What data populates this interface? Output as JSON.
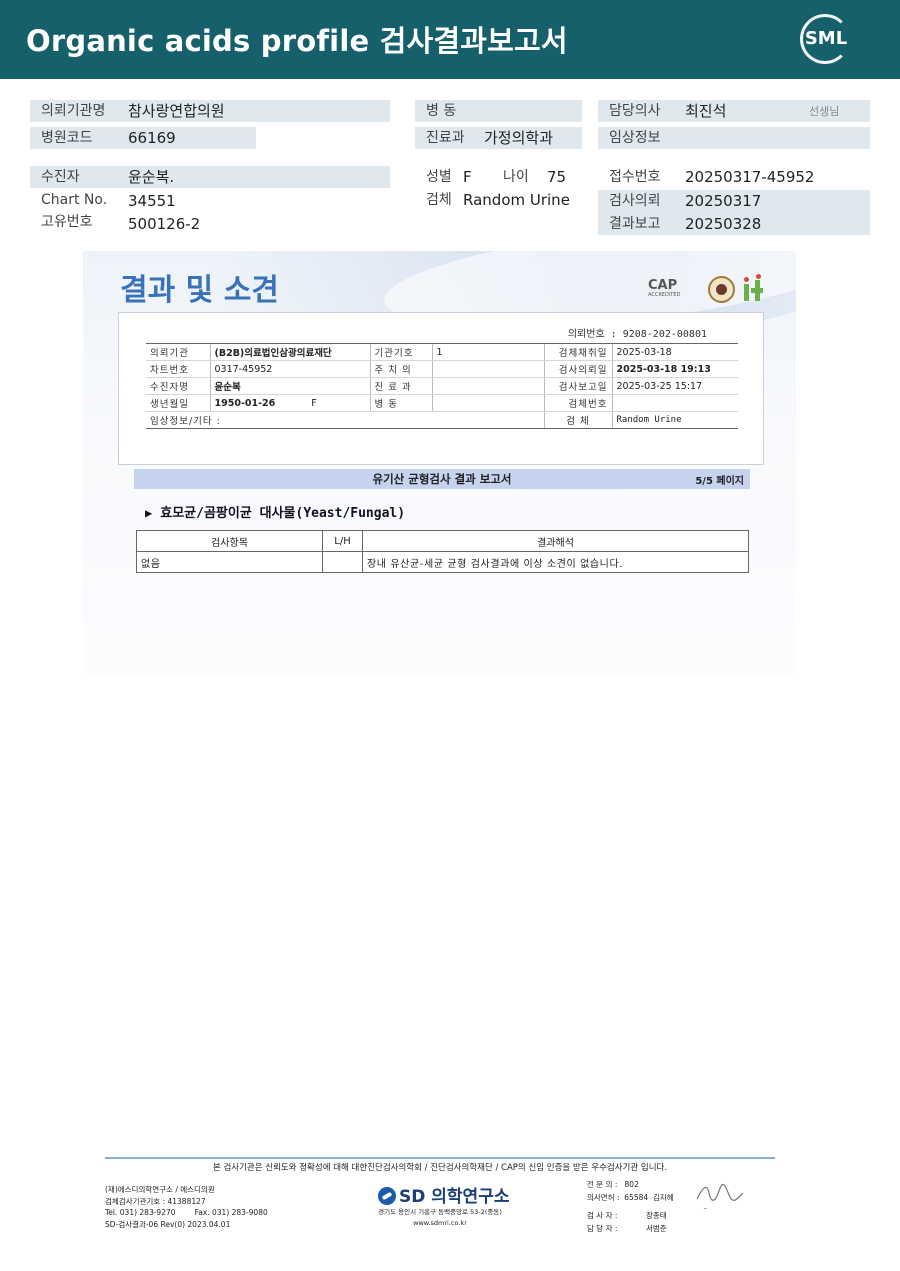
{
  "header": {
    "title": "Organic acids profile 검사결과보고서",
    "logo_text": "SML"
  },
  "info": {
    "institution_label": "의뢰기관명",
    "institution": "참사랑연합의원",
    "hospital_code_label": "병원코드",
    "hospital_code": "66169",
    "ward_label": "병 동",
    "ward": "",
    "department_label": "진료과",
    "department": "가정의학과",
    "doctor_label": "담당의사",
    "doctor": "최진석",
    "doctor_suffix": "선생님",
    "clinical_label": "임상정보",
    "clinical": "",
    "patient_label": "수진자",
    "patient": "윤순복.",
    "chart_label": "Chart No.",
    "chart": "34551",
    "unique_label": "고유번호",
    "unique": "500126-2",
    "sex_label": "성별",
    "sex": "F",
    "age_label": "나이",
    "age": "75",
    "specimen_label": "검체",
    "specimen": "Random Urine",
    "receipt_label": "접수번호",
    "receipt": "20250317-45952",
    "request_label": "검사의뢰",
    "request": "20250317",
    "report_label": "결과보고",
    "report": "20250328"
  },
  "report": {
    "heading": "결과 및 소견",
    "cap_text": "CAP",
    "cap_sub": "ACCREDITED",
    "request_no": "의뢰번호 : 9208-202-00801",
    "rows": [
      {
        "k1": "의뢰기관",
        "v1": "(B2B)의료법인삼광의료재단",
        "k2": "기관기호",
        "v2": "1",
        "k3": "검체채취일",
        "v3": "2025-03-18"
      },
      {
        "k1": "차트번호",
        "v1": "0317-45952",
        "k2": "주 치 의",
        "v2": "",
        "k3": "검사의뢰일",
        "v3": "2025-03-18 19:13"
      },
      {
        "k1": "수진자명",
        "v1": "윤순복",
        "k2": "진 료 과",
        "v2": "",
        "k3": "검사보고일",
        "v3": "2025-03-25 15:17"
      },
      {
        "k1": "생년월일",
        "v1": "1950-01-26",
        "v1b": "F",
        "k2": "병 동",
        "v2": "",
        "k3": "검체번호",
        "v3": ""
      },
      {
        "k1": "임상정보/기타 :",
        "v1": "",
        "k2": "",
        "v2": "",
        "k3": "검 체",
        "v3": "Random Urine"
      }
    ],
    "report_title": "유기산 균형검사 결과 보고서",
    "page": "5/5 페이지",
    "section_title": "효모균/곰팡이균 대사물(Yeast/Fungal)",
    "table_headers": [
      "검사항목",
      "L/H",
      "결과해석"
    ],
    "table_rows": [
      {
        "item": "없음",
        "lh": "",
        "interp": "장내 유산균-세균 균형 검사결과에 이상 소견이 없습니다."
      }
    ]
  },
  "footer": {
    "notice": "본 검사기관은 신뢰도와 정확성에 대해 대한진단검사의학회 / 진단검사의학재단 / CAP의 신임 인증을 받은 우수검사기관 입니다.",
    "left_lines": [
      "(재)에스디의학연구소 / 에스디의원",
      "검체검사기관기호 : 41388127",
      "Tel. 031) 283-9270        Fax. 031) 283-9080",
      "SD-검사결과-06 Rev(0) 2023.04.01"
    ],
    "brand": "SD 의학연구소",
    "address_lines": [
      "경기도 용인시 기흥구 동백중앙로 53-2(중동)",
      "www.sdmri.co.kr"
    ],
    "right_lines": [
      "전 문 의 :   802",
      "의사면허 :  65584  김지혜",
      "",
      "검 사 자 :            장종태",
      "담 당 자 :            서범준"
    ]
  }
}
